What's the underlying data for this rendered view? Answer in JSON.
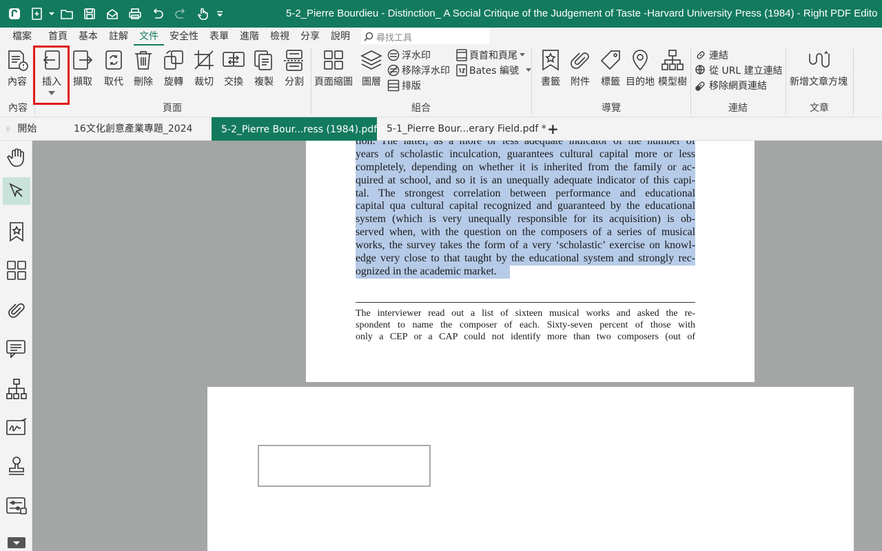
{
  "window": {
    "title": "5-2_Pierre Bourdieu - Distinction_ A Social Critique of the Judgement of Taste  -Harvard University Press (1984) - Right PDF Edito"
  },
  "menu": {
    "items": [
      "檔案",
      "首頁",
      "基本",
      "註解",
      "文件",
      "安全性",
      "表單",
      "進階",
      "檢視",
      "分享",
      "說明"
    ],
    "active": "文件",
    "search_placeholder": "尋找工具"
  },
  "ribbon": {
    "content_group": {
      "label": "內容",
      "buttons": [
        "內容"
      ]
    },
    "page_group": {
      "label": "頁面",
      "buttons": [
        "插入",
        "擷取",
        "取代",
        "刪除",
        "旋轉",
        "裁切",
        "交換",
        "複製",
        "分割"
      ]
    },
    "combine_group": {
      "label": "組合",
      "buttons": [
        "頁面縮圖",
        "圖層"
      ],
      "small": [
        "浮水印",
        "移除浮水印",
        "排版",
        "頁首和頁尾",
        "Bates 編號"
      ]
    },
    "nav_group": {
      "label": "導覽",
      "buttons": [
        "書籤",
        "附件",
        "標籤",
        "目的地",
        "模型樹"
      ]
    },
    "link_group": {
      "label": "連結",
      "small": [
        "連結",
        "從 URL 建立連結",
        "移除網頁連結"
      ]
    },
    "article_group": {
      "label": "文章",
      "buttons": [
        "新增文章方塊"
      ]
    }
  },
  "tabs": [
    {
      "label": "開始"
    },
    {
      "label": "16文化創意產業專題_2024"
    },
    {
      "label": "5-2_Pierre Bour...ress (1984).pdf *",
      "active": true
    },
    {
      "label": "5-1_Pierre Bour...erary Field.pdf *"
    }
  ],
  "document": {
    "selected_lines": [
      "tion. The latter, as a more or less adequate indicator of the number of",
      "years of scholastic inculcation, guarantees cultural capital more or less",
      "completely, depending on whether it is inherited from the family or ac-",
      "quired at school, and so it is an unequally adequate indicator of this capi-",
      "tal. The strongest correlation between performance and educational",
      "capital qua cultural capital recognized and guaranteed by the educational",
      "system (which is very unequally responsible for its acquisition) is ob-",
      "served when, with the question on the composers of a series of musical",
      "works, the survey takes the form of a very ‘scholastic’ exercise on knowl-",
      "edge very close to that taught by the educational system and strongly rec-",
      "ognized in the academic market."
    ],
    "footnote_lines": [
      "The interviewer read out a list of sixteen musical works and asked the re-",
      "spondent to name the composer of each. Sixty-seven percent of those with",
      "only a CEP or a CAP could not identify more than two composers (out of"
    ]
  },
  "colors": {
    "brand": "#137a5e",
    "highlight": "#e01919",
    "selection": "#b6cbe8"
  }
}
